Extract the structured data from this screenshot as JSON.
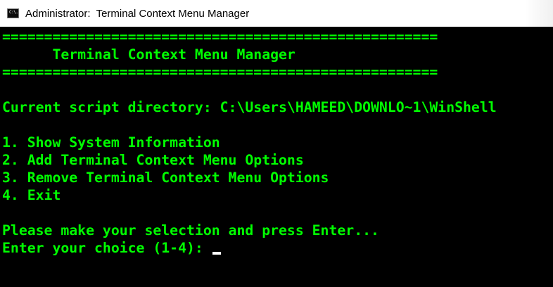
{
  "window": {
    "title": "Administrator:  Terminal Context Menu Manager",
    "icon": "cmd-icon",
    "icon_text": "C:\\."
  },
  "console": {
    "text_color": "#00ff00",
    "background": "#000000",
    "separator_top": "====================================================",
    "header": "      Terminal Context Menu Manager",
    "separator_bottom": "====================================================",
    "script_directory": "Current script directory: C:\\Users\\HAMEED\\DOWNLO~1\\WinShell",
    "menu": [
      "1. Show System Information",
      "2. Add Terminal Context Menu Options",
      "3. Remove Terminal Context Menu Options",
      "4. Exit"
    ],
    "instruction": "Please make your selection and press Enter...",
    "prompt": "Enter your choice (1-4): "
  }
}
